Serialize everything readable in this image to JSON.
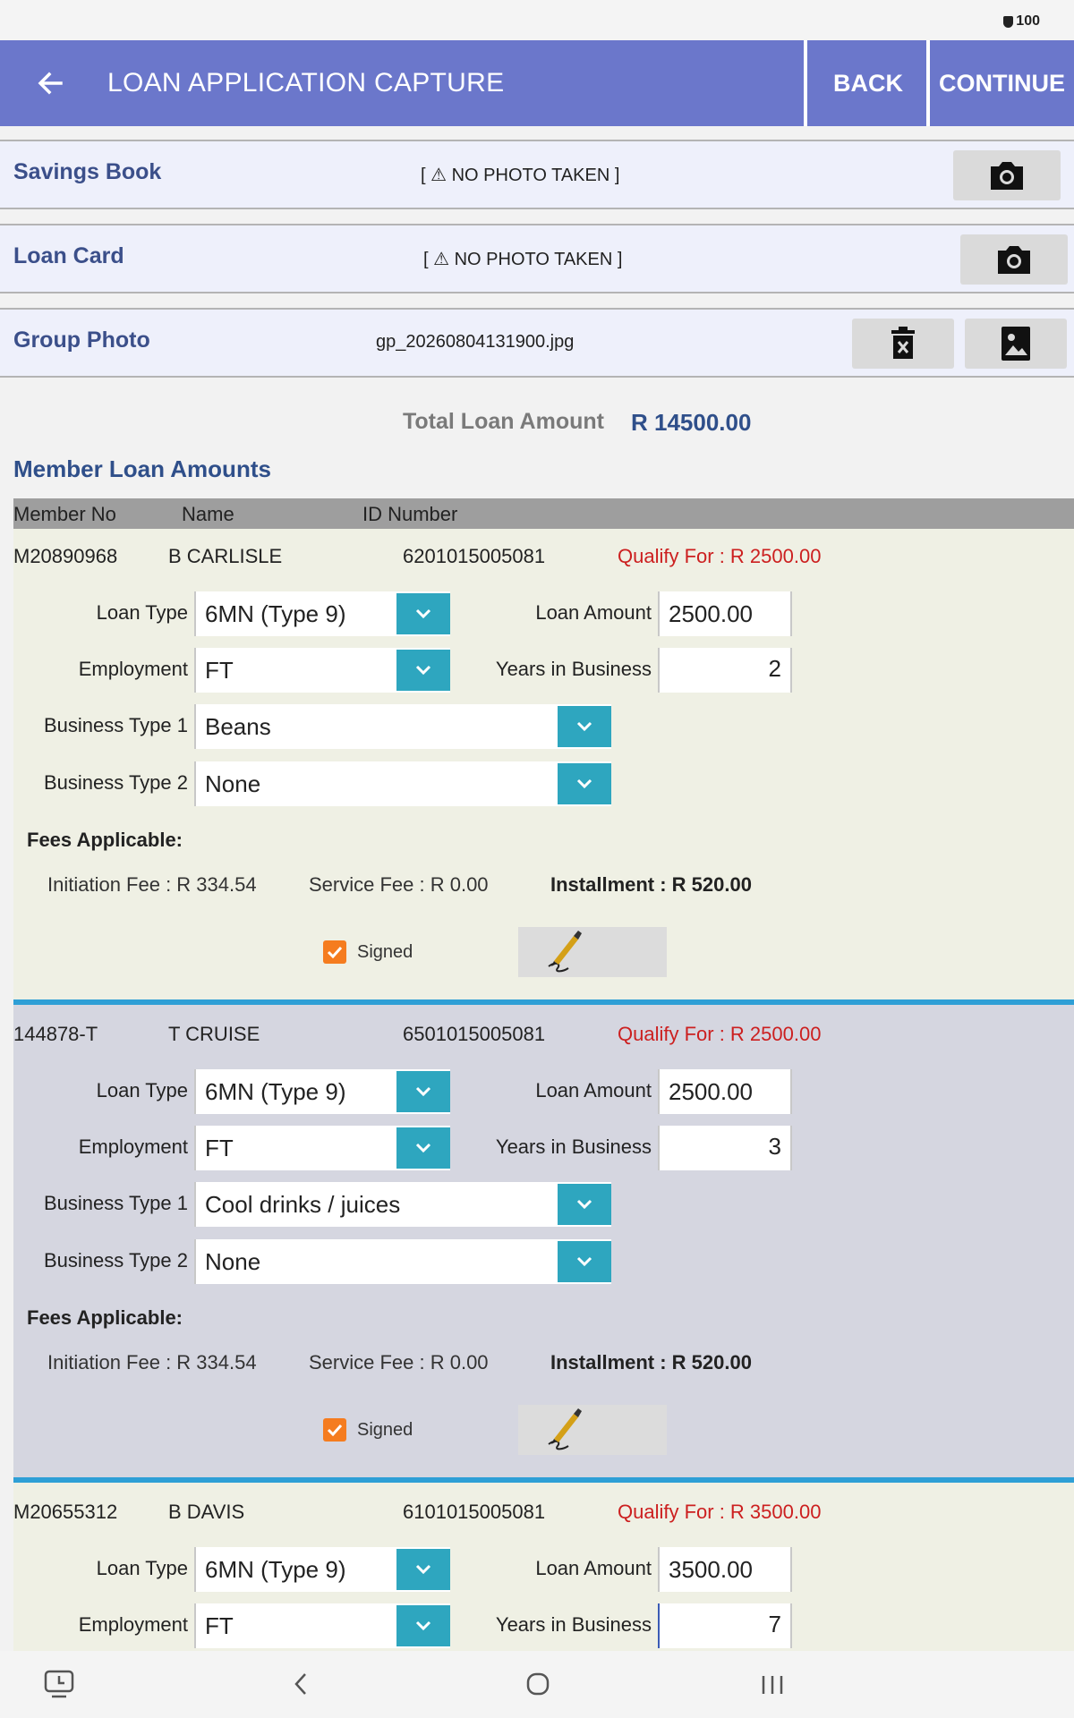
{
  "status_bar": {
    "battery": "100"
  },
  "app_bar": {
    "title": "LOAN APPLICATION CAPTURE",
    "back_label": "BACK",
    "continue_label": "CONTINUE"
  },
  "photos": [
    {
      "label": "Savings Book",
      "status": "[ ⚠ NO PHOTO TAKEN ]",
      "icon": "camera-icon"
    },
    {
      "label": "Loan Card",
      "status": "[ ⚠ NO PHOTO TAKEN ]",
      "icon": "camera-icon"
    },
    {
      "label": "Group Photo",
      "status": "gp_20260804131900.jpg",
      "icons": [
        "delete-icon",
        "image-icon"
      ]
    }
  ],
  "total": {
    "label": "Total Loan Amount",
    "value": "R 14500.00"
  },
  "section_title": "Member Loan Amounts",
  "table_headers": [
    "Member No",
    "Name",
    "ID Number"
  ],
  "field_labels": {
    "loan_type": "Loan Type",
    "loan_amount": "Loan Amount",
    "employment": "Employment",
    "years": "Years in Business",
    "business_type_1": "Business Type 1",
    "business_type_2": "Business Type 2",
    "fees_title": "Fees Applicable:",
    "signed": "Signed"
  },
  "members": [
    {
      "member_no": "M20890968",
      "name": "B CARLISLE",
      "id_number": "6201015005081",
      "qualify": "Qualify For : R 2500.00",
      "loan_type": "6MN (Type 9)",
      "loan_amount": "2500.00",
      "employment": "FT",
      "years": "2",
      "business_type_1": "Beans",
      "business_type_2": "None",
      "initiation_fee": "Initiation Fee : R 334.54",
      "service_fee": "Service Fee : R 0.00",
      "installment": "Installment : R 520.00",
      "signed": true
    },
    {
      "member_no": "144878-T",
      "name": "T CRUISE",
      "id_number": "6501015005081",
      "qualify": "Qualify For : R 2500.00",
      "loan_type": "6MN (Type 9)",
      "loan_amount": "2500.00",
      "employment": "FT",
      "years": "3",
      "business_type_1": "Cool drinks / juices",
      "business_type_2": "None",
      "initiation_fee": "Initiation Fee : R 334.54",
      "service_fee": "Service Fee : R 0.00",
      "installment": "Installment : R 520.00",
      "signed": true
    },
    {
      "member_no": "M20655312",
      "name": "B DAVIS",
      "id_number": "6101015005081",
      "qualify": "Qualify For : R 3500.00",
      "loan_type": "6MN (Type 9)",
      "loan_amount": "3500.00",
      "employment": "FT",
      "years": "7"
    }
  ],
  "colors": {
    "app_bar": "#6b77cb",
    "dropdown": "#2ea6bf",
    "qualify": "#cc1f1f",
    "title": "#2f4f8a",
    "separator": "#2e9fd6",
    "checkbox": "#f57c1f"
  }
}
